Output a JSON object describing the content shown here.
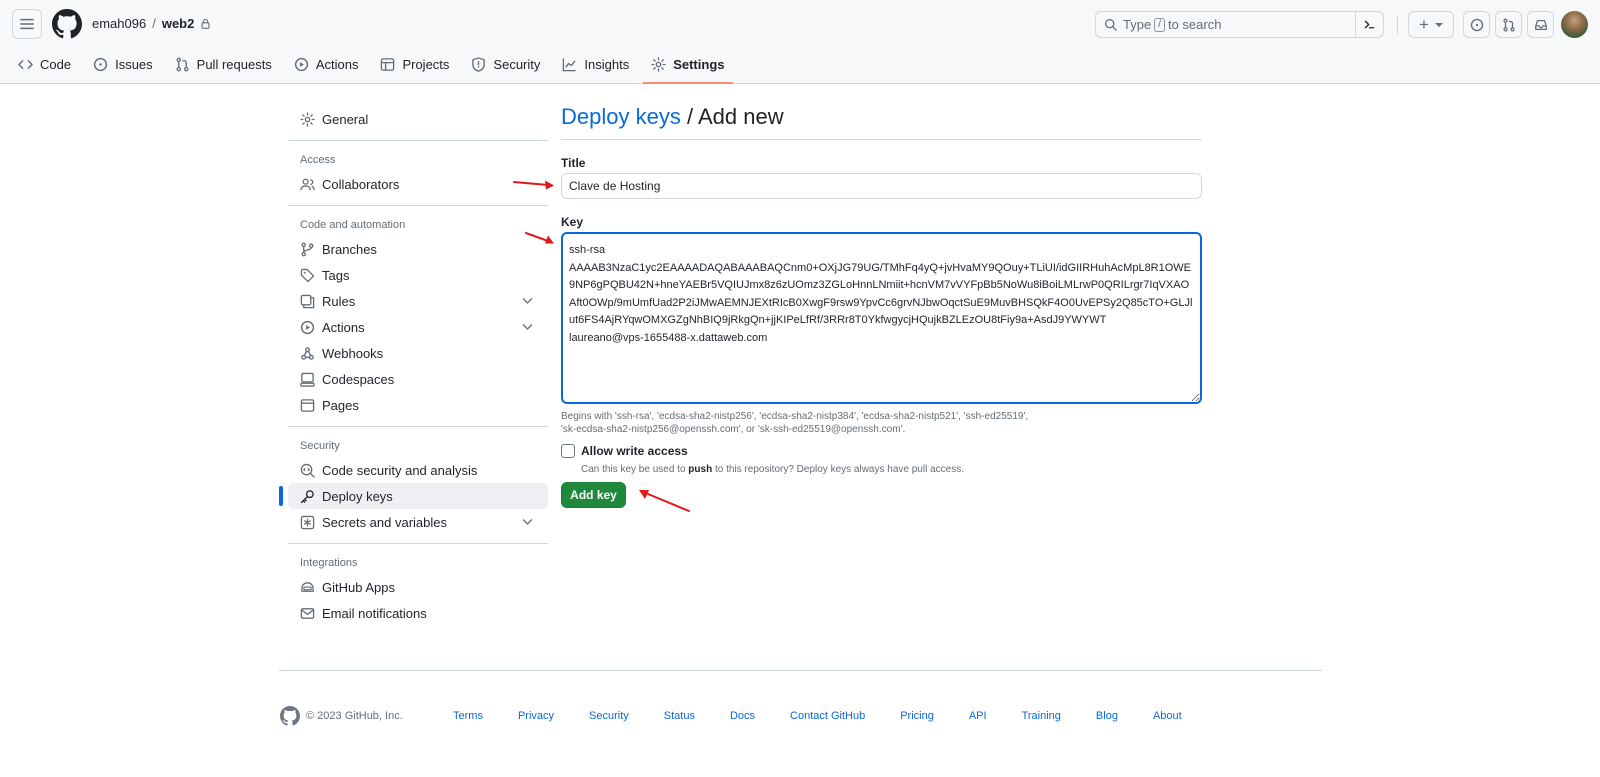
{
  "header": {
    "owner": "emah096",
    "separator": "/",
    "repo": "web2",
    "search_placeholder_prefix": "Type",
    "search_key": "/",
    "search_placeholder_suffix": "to search",
    "plus_label": "+"
  },
  "tabs": [
    {
      "label": "Code",
      "icon": "code-icon"
    },
    {
      "label": "Issues",
      "icon": "issue-icon"
    },
    {
      "label": "Pull requests",
      "icon": "pull-request-icon"
    },
    {
      "label": "Actions",
      "icon": "play-icon"
    },
    {
      "label": "Projects",
      "icon": "table-icon"
    },
    {
      "label": "Security",
      "icon": "shield-icon"
    },
    {
      "label": "Insights",
      "icon": "graph-icon"
    },
    {
      "label": "Settings",
      "icon": "gear-icon",
      "active": true
    }
  ],
  "sidebar": {
    "general": "General",
    "access_head": "Access",
    "collaborators": "Collaborators",
    "code_head": "Code and automation",
    "branches": "Branches",
    "tags": "Tags",
    "rules": "Rules",
    "actions": "Actions",
    "webhooks": "Webhooks",
    "codespaces": "Codespaces",
    "pages": "Pages",
    "security_head": "Security",
    "code_security": "Code security and analysis",
    "deploy_keys": "Deploy keys",
    "secrets": "Secrets and variables",
    "integrations_head": "Integrations",
    "github_apps": "GitHub Apps",
    "email_notifications": "Email notifications"
  },
  "main": {
    "title_link": "Deploy keys",
    "title_rest": " / Add new",
    "title_label": "Title",
    "title_value": "Clave de Hosting",
    "key_label": "Key",
    "key_value": "ssh-rsa\nAAAAB3NzaC1yc2EAAAADAQABAAABAQCnm0+OXjJG79UG/TMhFq4yQ+jvHvaMY9QOuy+TLiUI/idGIIRHuhAcMpL8R1OWE9NP6gPQBU42N+hneYAEBr5VQIUJmx8z6zUOmz3ZGLoHnnLNmiit+hcnVM7vVYFpBb5NoWu8iBoiLMLrwP0QRILrgr7IqVXAOAft0OWp/9mUmfUad2P2iJMwAEMNJEXtRIcB0XwgF9rsw9YpvCc6grvNJbwOqctSuE9MuvBHSQkF4O0UvEPSy2Q85cTO+GLJlut6FS4AjRYqwOMXGZgNhBIQ9jRkgQn+jjKIPeLfRf/3RRr8T0YkfwgycjHQujkBZLEzOU8tFiy9a+AsdJ9YWYWT\nlaureano@vps-1655488-x.dattaweb.com",
    "key_hint_1": "Begins with 'ssh-rsa', 'ecdsa-sha2-nistp256', 'ecdsa-sha2-nistp384', 'ecdsa-sha2-nistp521', 'ssh-ed25519',",
    "key_hint_2": "'sk-ecdsa-sha2-nistp256@openssh.com', or 'sk-ssh-ed25519@openssh.com'.",
    "allow_write": "Allow write access",
    "allow_hint_prefix": "Can this key be used to ",
    "allow_hint_bold": "push",
    "allow_hint_suffix": " to this repository? Deploy keys always have pull access.",
    "add_key": "Add key"
  },
  "footer": {
    "copyright": "© 2023 GitHub, Inc.",
    "links": [
      "Terms",
      "Privacy",
      "Security",
      "Status",
      "Docs",
      "Contact GitHub",
      "Pricing",
      "API",
      "Training",
      "Blog",
      "About"
    ]
  },
  "colors": {
    "link": "#0969da",
    "primary_button": "#1f883d",
    "active_tab_underline": "#fd8c73",
    "annotation_arrow": "#e5161a"
  }
}
